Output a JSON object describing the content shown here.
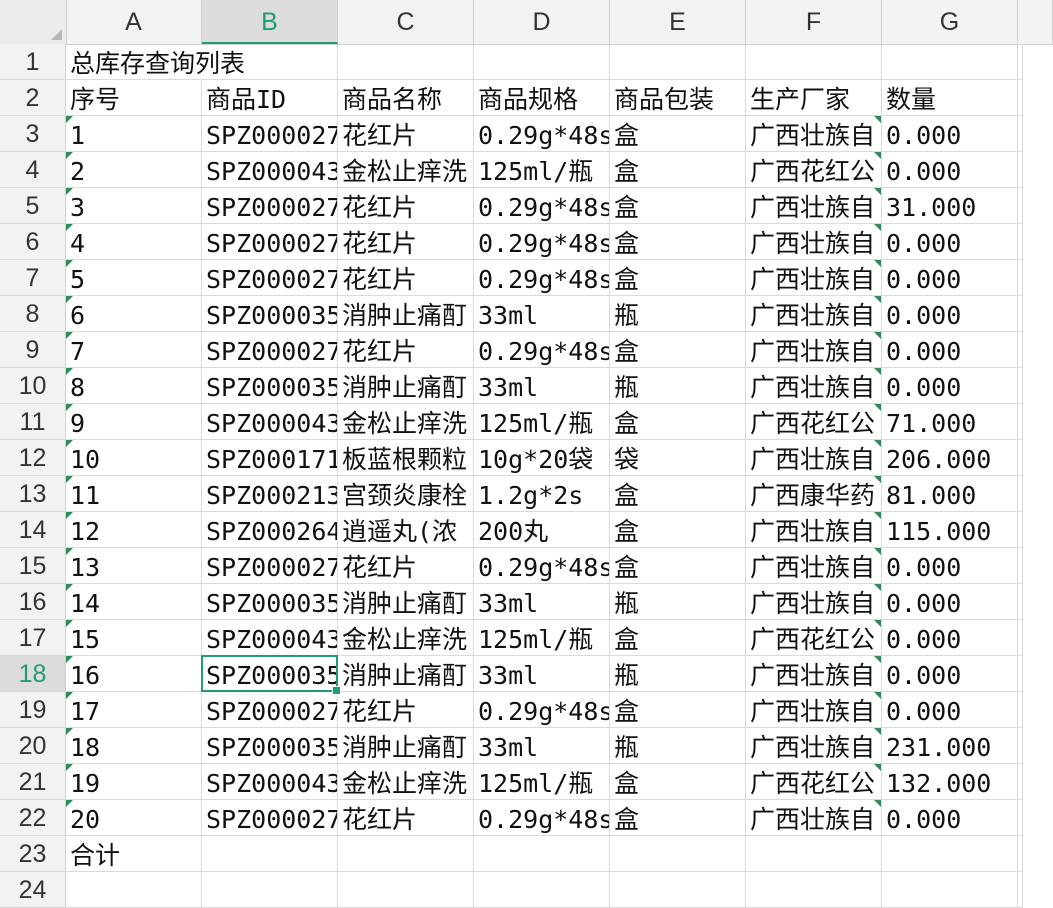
{
  "columns": [
    "A",
    "B",
    "C",
    "D",
    "E",
    "F",
    "G"
  ],
  "selected_column": "B",
  "selected_row": 18,
  "title_row": {
    "row": 1,
    "text": "总库存查询列表"
  },
  "header_row": {
    "row": 2,
    "cells": [
      "序号",
      "商品ID",
      "商品名称",
      "商品规格",
      "商品包装",
      "生产厂家",
      "数量"
    ]
  },
  "data_rows": [
    {
      "row": 3,
      "cells": [
        "1",
        "SPZ000027",
        "花红片",
        "0.29g*48s",
        "盒",
        "广西壮族自",
        "0.000"
      ]
    },
    {
      "row": 4,
      "cells": [
        "2",
        "SPZ000043",
        "金松止痒洗",
        "125ml/瓶",
        "盒",
        "广西花红公",
        "0.000"
      ]
    },
    {
      "row": 5,
      "cells": [
        "3",
        "SPZ000027",
        "花红片",
        "0.29g*48s",
        "盒",
        "广西壮族自",
        "31.000"
      ]
    },
    {
      "row": 6,
      "cells": [
        "4",
        "SPZ000027",
        "花红片",
        "0.29g*48s",
        "盒",
        "广西壮族自",
        "0.000"
      ]
    },
    {
      "row": 7,
      "cells": [
        "5",
        "SPZ000027",
        "花红片",
        "0.29g*48s",
        "盒",
        "广西壮族自",
        "0.000"
      ]
    },
    {
      "row": 8,
      "cells": [
        "6",
        "SPZ000035",
        "消肿止痛酊",
        "33ml",
        "瓶",
        "广西壮族自",
        "0.000"
      ]
    },
    {
      "row": 9,
      "cells": [
        "7",
        "SPZ000027",
        "花红片",
        "0.29g*48s",
        "盒",
        "广西壮族自",
        "0.000"
      ]
    },
    {
      "row": 10,
      "cells": [
        "8",
        "SPZ000035",
        "消肿止痛酊",
        "33ml",
        "瓶",
        "广西壮族自",
        "0.000"
      ]
    },
    {
      "row": 11,
      "cells": [
        "9",
        "SPZ000043",
        "金松止痒洗",
        "125ml/瓶",
        "盒",
        "广西花红公",
        "71.000"
      ]
    },
    {
      "row": 12,
      "cells": [
        "10",
        "SPZ000171",
        "板蓝根颗粒",
        "10g*20袋",
        "袋",
        "广西壮族自",
        "206.000"
      ]
    },
    {
      "row": 13,
      "cells": [
        "11",
        "SPZ000213",
        "宫颈炎康栓",
        "1.2g*2s",
        "盒",
        "广西康华药",
        "81.000"
      ]
    },
    {
      "row": 14,
      "cells": [
        "12",
        "SPZ000264",
        "逍遥丸(浓",
        "200丸",
        "盒",
        "广西壮族自",
        "115.000"
      ]
    },
    {
      "row": 15,
      "cells": [
        "13",
        "SPZ000027",
        "花红片",
        "0.29g*48s",
        "盒",
        "广西壮族自",
        "0.000"
      ]
    },
    {
      "row": 16,
      "cells": [
        "14",
        "SPZ000035",
        "消肿止痛酊",
        "33ml",
        "瓶",
        "广西壮族自",
        "0.000"
      ]
    },
    {
      "row": 17,
      "cells": [
        "15",
        "SPZ000043",
        "金松止痒洗",
        "125ml/瓶",
        "盒",
        "广西花红公",
        "0.000"
      ]
    },
    {
      "row": 18,
      "cells": [
        "16",
        "SPZ000035",
        "消肿止痛酊",
        "33ml",
        "瓶",
        "广西壮族自",
        "0.000"
      ]
    },
    {
      "row": 19,
      "cells": [
        "17",
        "SPZ000027",
        "花红片",
        "0.29g*48s",
        "盒",
        "广西壮族自",
        "0.000"
      ]
    },
    {
      "row": 20,
      "cells": [
        "18",
        "SPZ000035",
        "消肿止痛酊",
        "33ml",
        "瓶",
        "广西壮族自",
        "231.000"
      ]
    },
    {
      "row": 21,
      "cells": [
        "19",
        "SPZ000043",
        "金松止痒洗",
        "125ml/瓶",
        "盒",
        "广西花红公",
        "132.000"
      ]
    },
    {
      "row": 22,
      "cells": [
        "20",
        "SPZ000027",
        "花红片",
        "0.29g*48s",
        "盒",
        "广西壮族自",
        "0.000"
      ]
    }
  ],
  "total_row": {
    "row": 23,
    "text": "合计"
  },
  "next_row_number": 24,
  "colors": {
    "selection": "#1e9e6a",
    "text_marker": "#2e8b57"
  }
}
